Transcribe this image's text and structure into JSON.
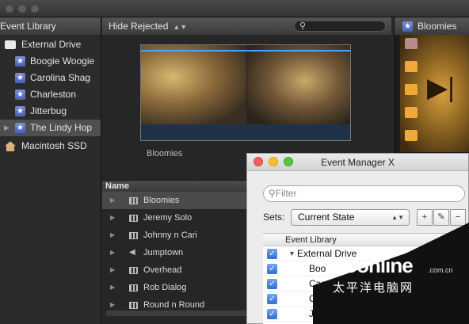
{
  "library": {
    "header": "Event Library",
    "items": [
      {
        "label": "External Drive",
        "icon": "drive-icon"
      },
      {
        "label": "Boogie Woogie",
        "icon": "star-icon"
      },
      {
        "label": "Carolina Shag",
        "icon": "star-icon"
      },
      {
        "label": "Charleston",
        "icon": "star-icon"
      },
      {
        "label": "Jitterbug",
        "icon": "star-icon"
      },
      {
        "label": "The Lindy Hop",
        "icon": "star-icon",
        "selected": true
      },
      {
        "label": "Macintosh SSD",
        "icon": "house-icon"
      }
    ]
  },
  "browser": {
    "filter_label": "Hide Rejected",
    "clip_label": "Bloomies",
    "column_header": "Name",
    "rows": [
      {
        "label": "Bloomies",
        "icon": "filmstrip-icon",
        "selected": true
      },
      {
        "label": "Jeremy Solo",
        "icon": "filmstrip-icon"
      },
      {
        "label": "Johnny n Cari",
        "icon": "filmstrip-icon"
      },
      {
        "label": "Jumptown",
        "icon": "speaker-icon"
      },
      {
        "label": "Overhead",
        "icon": "filmstrip-icon"
      },
      {
        "label": "Rob Dialog",
        "icon": "filmstrip-icon"
      },
      {
        "label": "Round n Round",
        "icon": "filmstrip-icon"
      }
    ]
  },
  "viewer": {
    "title": "Bloomies"
  },
  "dialog": {
    "title": "Event Manager X",
    "search_placeholder": "Filter",
    "sets_label": "Sets:",
    "sets_value": "Current State",
    "column_header": "Event Library",
    "rows": [
      {
        "label": "External Drive",
        "checked": true
      },
      {
        "label": "Boo",
        "checked": true
      },
      {
        "label": "Car",
        "checked": true
      },
      {
        "label": "Cha",
        "checked": true
      },
      {
        "label": "Jitt",
        "checked": true
      }
    ]
  },
  "watermark": {
    "brand": "PConline",
    "chinese": "太平洋电脑网",
    "domain": ".com.cn"
  }
}
